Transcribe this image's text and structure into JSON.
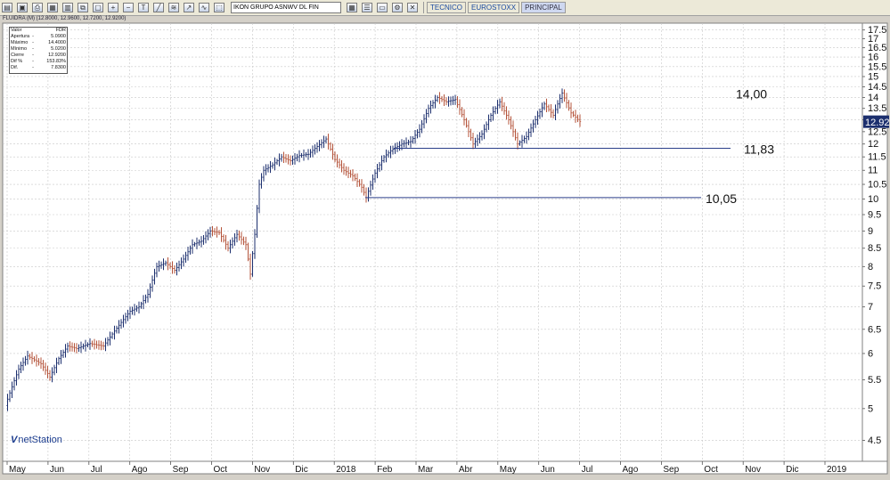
{
  "toolbar": {
    "icons": [
      "open-icon",
      "save-icon",
      "print-icon",
      "chart-icon",
      "compare-icon",
      "copy-icon",
      "paste-icon",
      "zoom-in-icon",
      "zoom-out-icon",
      "text-icon",
      "trendline-icon",
      "fibonacci-icon",
      "arrow-icon",
      "indicator-icon",
      "select-icon"
    ],
    "ticker_value": "IKON GRUPO ASNWV DL FIN",
    "right_icons": [
      "grid-icon",
      "list-icon",
      "window-icon",
      "settings-icon",
      "close-icon"
    ],
    "tabs": [
      {
        "label": "TECNICO",
        "active": false
      },
      {
        "label": "EUROSTOXX",
        "active": false
      },
      {
        "label": "PRINCIPAL",
        "active": true
      }
    ]
  },
  "chart_header": "FLUIDRA (M) (12.8000, 12.9600, 12.7200, 12.9200)",
  "info_box": [
    {
      "key": "Valor",
      "dash": "",
      "value": "FDR"
    },
    {
      "key": "Apertura",
      "dash": "-",
      "value": "5.0900"
    },
    {
      "key": "Máximo",
      "dash": "-",
      "value": "14.4000"
    },
    {
      "key": "Mínimo",
      "dash": "-",
      "value": "5.0200"
    },
    {
      "key": "Cierre",
      "dash": "-",
      "value": "12.9200"
    },
    {
      "key": "Dif %",
      "dash": "-",
      "value": "153.83%"
    },
    {
      "key": "Dif.",
      "dash": "-",
      "value": "7.8300"
    }
  ],
  "watermark": "netStation",
  "colors": {
    "background": "#ffffff",
    "grid": "#c8c8c8",
    "up_bar": "#1c2f6e",
    "down_bar": "#b4533a",
    "support_line": "#2b3f8a",
    "last_price_bg": "#1c2f6e"
  },
  "chart_data": {
    "type": "ohlc",
    "title": "",
    "xlabel": "",
    "ylabel": "",
    "y_scale": "log",
    "ylim": [
      4.2,
      17.9
    ],
    "y_ticks": [
      4.5,
      5.0,
      5.5,
      6.0,
      6.5,
      7.0,
      7.5,
      8.0,
      8.5,
      9.0,
      9.5,
      10.0,
      10.5,
      11.0,
      11.5,
      12.0,
      12.5,
      13.0,
      13.5,
      14.0,
      14.5,
      15.0,
      15.5,
      16.0,
      16.5,
      17.0,
      17.5
    ],
    "x_tick_labels": [
      "May",
      "Jun",
      "Jul",
      "Ago",
      "Sep",
      "Oct",
      "Nov",
      "Dic",
      "2018",
      "Feb",
      "Mar",
      "Abr",
      "May",
      "Jun",
      "Jul",
      "Ago",
      "Sep",
      "Oct",
      "Nov",
      "Dic",
      "2019"
    ],
    "last_price": "12.92",
    "price_path": [
      [
        0,
        5.05
      ],
      [
        6,
        5.7
      ],
      [
        10,
        5.95
      ],
      [
        16,
        5.8
      ],
      [
        20,
        5.55
      ],
      [
        24,
        5.9
      ],
      [
        28,
        6.15
      ],
      [
        32,
        6.1
      ],
      [
        38,
        6.2
      ],
      [
        44,
        6.15
      ],
      [
        48,
        6.4
      ],
      [
        52,
        6.65
      ],
      [
        56,
        6.9
      ],
      [
        60,
        7.0
      ],
      [
        64,
        7.3
      ],
      [
        68,
        8.0
      ],
      [
        72,
        8.1
      ],
      [
        76,
        7.9
      ],
      [
        80,
        8.2
      ],
      [
        84,
        8.6
      ],
      [
        88,
        8.7
      ],
      [
        92,
        9.0
      ],
      [
        96,
        8.95
      ],
      [
        100,
        8.5
      ],
      [
        104,
        8.9
      ],
      [
        108,
        8.6
      ],
      [
        110,
        7.8
      ],
      [
        112,
        8.9
      ],
      [
        114,
        10.5
      ],
      [
        116,
        11.0
      ],
      [
        120,
        11.2
      ],
      [
        124,
        11.5
      ],
      [
        128,
        11.35
      ],
      [
        132,
        11.55
      ],
      [
        136,
        11.6
      ],
      [
        140,
        11.9
      ],
      [
        144,
        12.2
      ],
      [
        148,
        11.4
      ],
      [
        152,
        11.0
      ],
      [
        156,
        10.8
      ],
      [
        160,
        10.4
      ],
      [
        162,
        10.05
      ],
      [
        166,
        10.9
      ],
      [
        170,
        11.5
      ],
      [
        174,
        11.8
      ],
      [
        178,
        12.0
      ],
      [
        182,
        12.1
      ],
      [
        186,
        12.6
      ],
      [
        190,
        13.5
      ],
      [
        194,
        14.0
      ],
      [
        198,
        13.8
      ],
      [
        202,
        13.9
      ],
      [
        206,
        13.0
      ],
      [
        210,
        12.0
      ],
      [
        214,
        12.4
      ],
      [
        218,
        13.2
      ],
      [
        222,
        13.8
      ],
      [
        226,
        13.0
      ],
      [
        230,
        12.0
      ],
      [
        234,
        12.3
      ],
      [
        238,
        13.0
      ],
      [
        242,
        13.7
      ],
      [
        246,
        13.2
      ],
      [
        250,
        14.2
      ],
      [
        254,
        13.3
      ],
      [
        258,
        12.92
      ]
    ],
    "annotations": [
      {
        "type": "label",
        "text": "14,00"
      },
      {
        "type": "hline",
        "y": 11.83,
        "label": "11,83"
      },
      {
        "type": "hline",
        "y": 10.05,
        "label": "10,05"
      }
    ]
  }
}
